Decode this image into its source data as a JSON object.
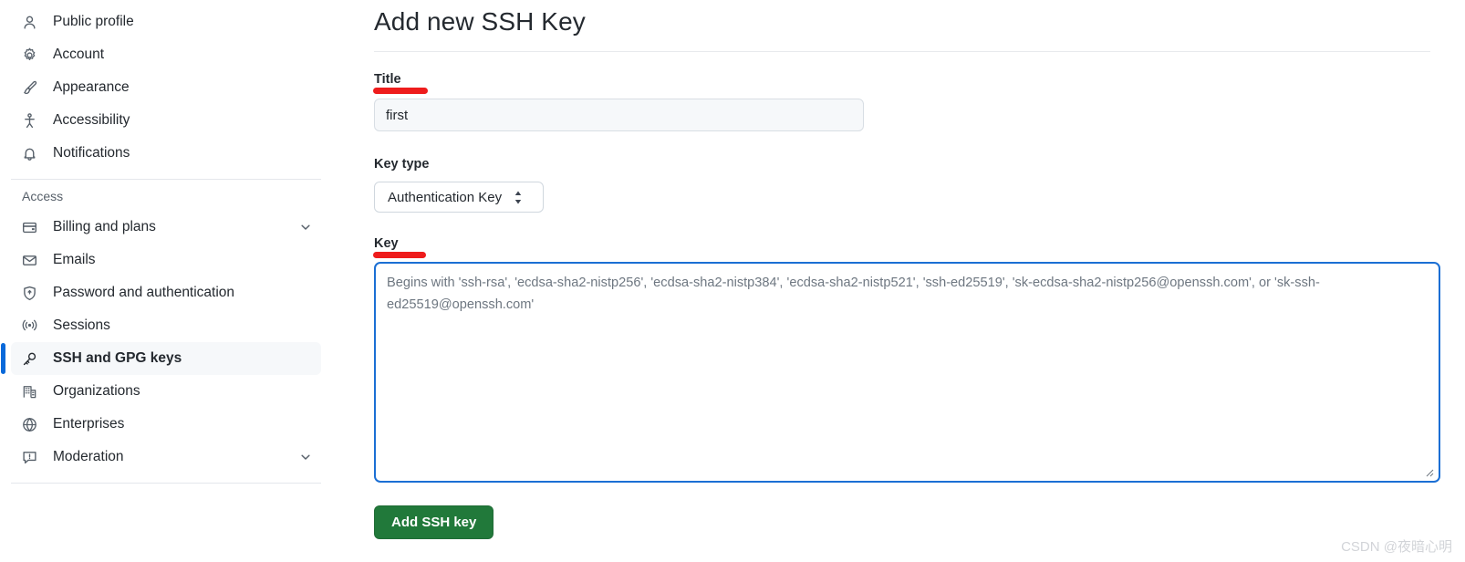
{
  "sidebar": {
    "top_items": [
      {
        "label": "Public profile",
        "icon": "person-icon",
        "chevron": false
      },
      {
        "label": "Account",
        "icon": "gear-icon",
        "chevron": false
      },
      {
        "label": "Appearance",
        "icon": "paintbrush-icon",
        "chevron": false
      },
      {
        "label": "Accessibility",
        "icon": "accessibility-icon",
        "chevron": false
      },
      {
        "label": "Notifications",
        "icon": "bell-icon",
        "chevron": false
      }
    ],
    "section_title": "Access",
    "access_items": [
      {
        "label": "Billing and plans",
        "icon": "credit-card-icon",
        "chevron": true
      },
      {
        "label": "Emails",
        "icon": "envelope-icon",
        "chevron": false
      },
      {
        "label": "Password and authentication",
        "icon": "shield-lock-icon",
        "chevron": false
      },
      {
        "label": "Sessions",
        "icon": "broadcast-icon",
        "chevron": false
      },
      {
        "label": "SSH and GPG keys",
        "icon": "key-icon",
        "chevron": false,
        "selected": true
      },
      {
        "label": "Organizations",
        "icon": "organization-icon",
        "chevron": false
      },
      {
        "label": "Enterprises",
        "icon": "globe-icon",
        "chevron": false
      },
      {
        "label": "Moderation",
        "icon": "report-icon",
        "chevron": true
      }
    ]
  },
  "main": {
    "page_title": "Add new SSH Key",
    "title_field": {
      "label": "Title",
      "value": "first",
      "placeholder": ""
    },
    "key_type_field": {
      "label": "Key type",
      "selected": "Authentication Key"
    },
    "key_field": {
      "label": "Key",
      "value": "",
      "placeholder": "Begins with 'ssh-rsa', 'ecdsa-sha2-nistp256', 'ecdsa-sha2-nistp384', 'ecdsa-sha2-nistp521', 'ssh-ed25519', 'sk-ecdsa-sha2-nistp256@openssh.com', or 'sk-ssh-ed25519@openssh.com'"
    },
    "submit_label": "Add SSH key"
  },
  "watermark": "CSDN @夜暗心明",
  "colors": {
    "accent_blue": "#0969da",
    "focus_blue": "#1b6fd4",
    "green_button": "#21793a",
    "annotation_red": "#ee1c1c",
    "selected_bg": "#f6f8fa",
    "text": "#24292f",
    "muted_text": "#57606a"
  }
}
